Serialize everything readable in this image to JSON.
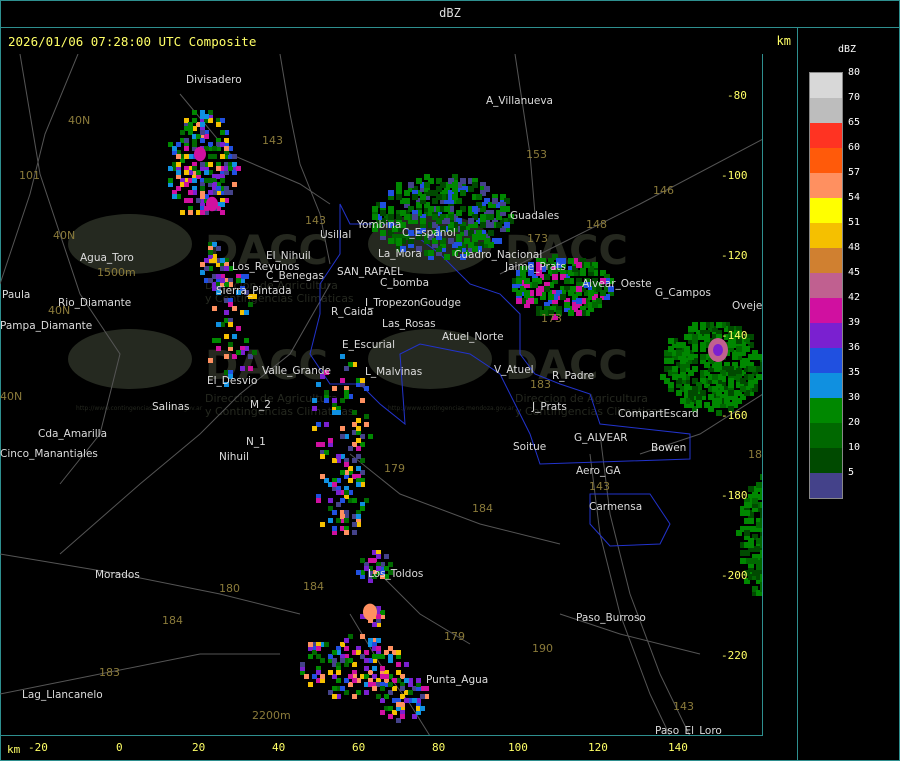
{
  "header": {
    "title": "dBZ"
  },
  "map": {
    "timestamp": "2026/01/06 07:28:00 UTC Composite",
    "units_label": "km",
    "x_axis_label": "km",
    "x_ticks": [
      "-20",
      "0",
      "20",
      "40",
      "60",
      "80",
      "100",
      "120",
      "140"
    ],
    "y_ticks": [
      "-80",
      "-100",
      "-120",
      "-140",
      "-160",
      "-180",
      "-200",
      "-220"
    ],
    "places": [
      {
        "name": "Divisadero"
      },
      {
        "name": "A_Villanueva"
      },
      {
        "name": "Guadales"
      },
      {
        "name": "Yombina"
      },
      {
        "name": "Usillal"
      },
      {
        "name": "C_Espanol"
      },
      {
        "name": "La_Mora"
      },
      {
        "name": "Agua_Toro"
      },
      {
        "name": "Los_Reyunos"
      },
      {
        "name": "Rio_Diamante"
      },
      {
        "name": "Pampa_Diamante"
      },
      {
        "name": "Paula"
      },
      {
        "name": "C_Benegas"
      },
      {
        "name": "SAN_RAFAEL"
      },
      {
        "name": "El_Nihuil"
      },
      {
        "name": "C_bomba"
      },
      {
        "name": "I_Tropezon"
      },
      {
        "name": "Goudge"
      },
      {
        "name": "Cuadro_Nacional"
      },
      {
        "name": "Sierra_Pintada"
      },
      {
        "name": "R_Caida"
      },
      {
        "name": "Las_Rosas"
      },
      {
        "name": "Atuel_Norte"
      },
      {
        "name": "Jaime_Prats"
      },
      {
        "name": "Alvear_Oeste"
      },
      {
        "name": "G_Campos"
      },
      {
        "name": "Ovejeria"
      },
      {
        "name": "E_Escurial"
      },
      {
        "name": "El_Desvio"
      },
      {
        "name": "Valle_Grande"
      },
      {
        "name": "L_Malvinas"
      },
      {
        "name": "V_Atuel"
      },
      {
        "name": "R_Padre"
      },
      {
        "name": "Salinas"
      },
      {
        "name": "M_2"
      },
      {
        "name": "J_Prats"
      },
      {
        "name": "CompartEscard"
      },
      {
        "name": "Cda_Amarilla"
      },
      {
        "name": "Cinco_Manantiales"
      },
      {
        "name": "N_1"
      },
      {
        "name": "Nihuil"
      },
      {
        "name": "Soitue"
      },
      {
        "name": "G_ALVEAR"
      },
      {
        "name": "Bowen"
      },
      {
        "name": "Aero_GA"
      },
      {
        "name": "Carmensa"
      },
      {
        "name": "Morados"
      },
      {
        "name": "Los_Toldos"
      },
      {
        "name": "Paso_Burroso"
      },
      {
        "name": "Punta_Agua"
      },
      {
        "name": "Lag_Llancanelo"
      },
      {
        "name": "Paso_El_Loro"
      },
      {
        "name": "1500m"
      },
      {
        "name": "2200m"
      }
    ],
    "route_numbers": [
      "40N",
      "101",
      "40N",
      "40N",
      "143",
      "143",
      "153",
      "146",
      "148",
      "173",
      "173",
      "40N",
      "183",
      "143",
      "179",
      "184",
      "180",
      "184",
      "184",
      "183",
      "179",
      "190",
      "143",
      "18"
    ],
    "watermark": {
      "brand": "DACC",
      "sub1": "Direccion de Agricultura",
      "sub2": "y Contingencias Climaticas",
      "url": "http://www.contingencias.mendoza.gov.ar"
    }
  },
  "legend": {
    "title": "dBZ",
    "items": [
      {
        "value": "80",
        "color": "#d8d8d8"
      },
      {
        "value": "70",
        "color": "#bdbdbd"
      },
      {
        "value": "65",
        "color": "#ff3322"
      },
      {
        "value": "60",
        "color": "#ff5a0a"
      },
      {
        "value": "57",
        "color": "#ff9060"
      },
      {
        "value": "54",
        "color": "#ffff00"
      },
      {
        "value": "51",
        "color": "#f5c000"
      },
      {
        "value": "48",
        "color": "#d08030"
      },
      {
        "value": "45",
        "color": "#c06090"
      },
      {
        "value": "42",
        "color": "#d010a0"
      },
      {
        "value": "39",
        "color": "#7a20d0"
      },
      {
        "value": "36",
        "color": "#2050e0"
      },
      {
        "value": "35",
        "color": "#1090e0"
      },
      {
        "value": "30",
        "color": "#008800"
      },
      {
        "value": "20",
        "color": "#006800"
      },
      {
        "value": "10",
        "color": "#004a00"
      },
      {
        "value": "5",
        "color": "#44428a"
      }
    ]
  }
}
